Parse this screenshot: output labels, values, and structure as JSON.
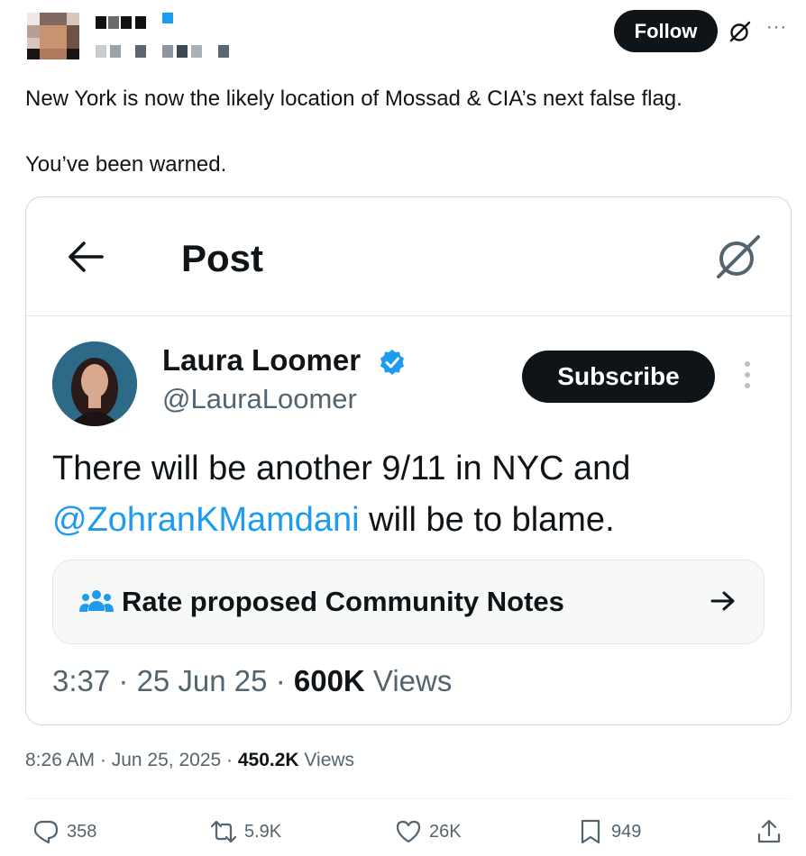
{
  "header": {
    "follow_label": "Follow",
    "more_label": "···"
  },
  "tweet": {
    "line1": "New York is now the likely location of Mossad & CIA’s next false flag.",
    "line2": "You’ve been warned."
  },
  "embedded": {
    "title": "Post",
    "author_name": "Laura Loomer",
    "author_handle": "@LauraLoomer",
    "subscribe_label": "Subscribe",
    "text_line1": "There will be another 9/11 in NYC and",
    "mention": "@ZohranKMamdani",
    "text_line2_rest": " will be to blame.",
    "community_notes_label": "Rate proposed Community Notes",
    "time": "3:37",
    "date": "25 Jun 25",
    "views_count": "600K",
    "views_label": "Views",
    "separator": " · "
  },
  "meta": {
    "time": "8:26 AM",
    "date": "Jun 25, 2025",
    "views_count": "450.2K",
    "views_label": "Views",
    "separator": " · "
  },
  "actions": {
    "replies": "358",
    "reposts": "5.9K",
    "likes": "26K",
    "bookmarks": "949"
  },
  "colors": {
    "accent": "#1d9bf0",
    "text": "#0f1419",
    "muted": "#536471",
    "button_dark": "#0f1419"
  },
  "icons": [
    "grok-icon",
    "more-icon",
    "back-arrow-icon",
    "verified-badge-icon",
    "kebab-icon",
    "community-notes-icon",
    "arrow-right-icon",
    "reply-icon",
    "repost-icon",
    "like-icon",
    "bookmark-icon",
    "share-icon"
  ]
}
